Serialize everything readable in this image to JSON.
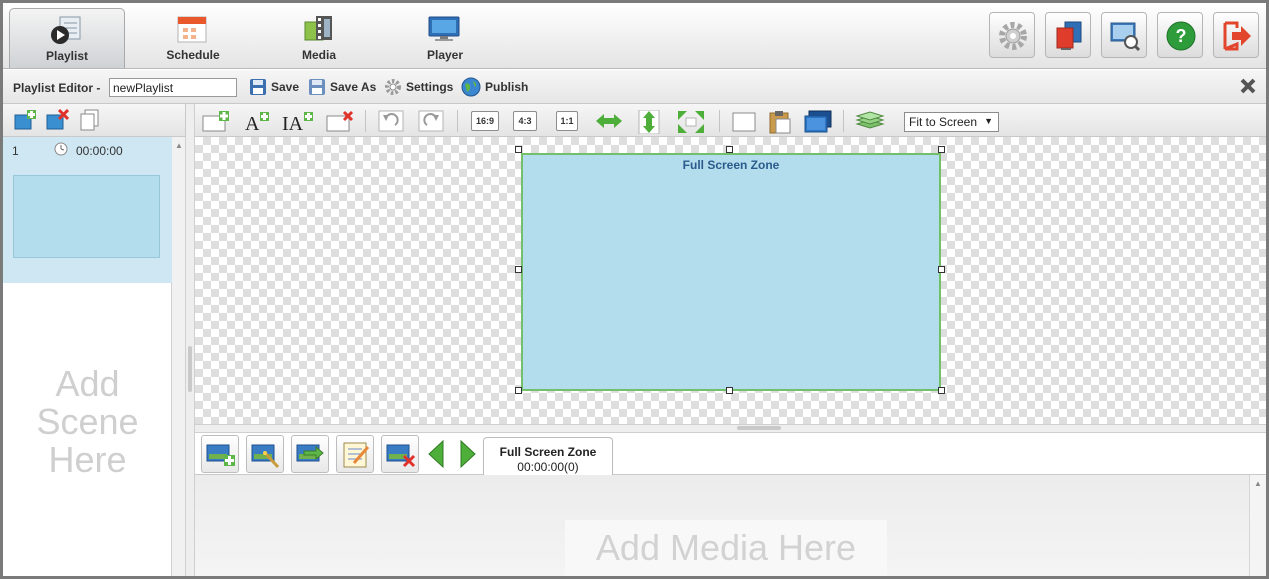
{
  "nav": {
    "tabs": [
      {
        "label": "Playlist",
        "icon": "playlist-icon",
        "active": true
      },
      {
        "label": "Schedule",
        "icon": "calendar-icon",
        "active": false
      },
      {
        "label": "Media",
        "icon": "film-icon",
        "active": false
      },
      {
        "label": "Player",
        "icon": "monitor-icon",
        "active": false
      }
    ],
    "system_buttons": [
      "gear-icon",
      "sync-icon",
      "display-search-icon",
      "help-icon",
      "logout-icon"
    ]
  },
  "editor": {
    "title": "Playlist Editor -",
    "playlist_name": "newPlaylist",
    "save_label": "Save",
    "save_as_label": "Save As",
    "settings_label": "Settings",
    "publish_label": "Publish"
  },
  "scenes": {
    "items": [
      {
        "number": "1",
        "duration": "00:00:00"
      }
    ],
    "add_placeholder": "Add Scene Here"
  },
  "canvas_toolbar": {
    "ratio_169": "16:9",
    "ratio_43": "4:3",
    "ratio_11": "1:1",
    "fit_option": "Fit to Screen"
  },
  "canvas": {
    "zone_label": "Full Screen Zone"
  },
  "media": {
    "zone_tab_title": "Full Screen Zone",
    "zone_tab_duration": "00:00:00(0)",
    "add_placeholder": "Add  Media  Here"
  },
  "colors": {
    "zone_fill": "#b3dcec",
    "zone_border": "#73c06a",
    "selected_scene": "#cfe7f3",
    "help_green": "#2e9c3a",
    "logout_red": "#e2452b"
  }
}
